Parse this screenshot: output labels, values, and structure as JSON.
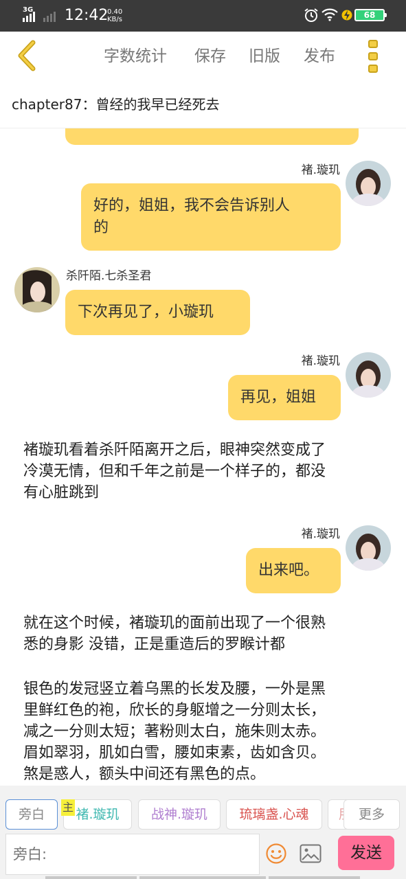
{
  "status_bar": {
    "network": "3G",
    "time": "12:42",
    "speed_value": "0.40",
    "speed_unit": "KB/s",
    "battery": "68",
    "icons": [
      "alarm-icon",
      "wifi-icon",
      "charging-icon",
      "battery-icon"
    ]
  },
  "toolbar": {
    "word_count": "字数统计",
    "save": "保存",
    "old_version": "旧版",
    "publish": "发布"
  },
  "chapter": {
    "title": "chapter87：曾经的我早已经死去"
  },
  "messages": [
    {
      "type": "right",
      "name": "褚.璇玑",
      "text_line1": "好的，姐姐，我不会告诉别人",
      "text_line2": "的"
    },
    {
      "type": "left",
      "name": "杀阡陌.七杀圣君",
      "text": "下次再见了，小璇玑"
    },
    {
      "type": "right",
      "name": "褚.璇玑",
      "text": "再见，姐姐"
    },
    {
      "type": "narration",
      "lines": [
        "褚璇玑看着杀阡陌离开之后，眼神突然变成了",
        "冷漠无情，但和千年之前是一个样子的，都没",
        "有心脏跳到"
      ]
    },
    {
      "type": "right",
      "name": "褚.璇玑",
      "text": "出来吧。"
    },
    {
      "type": "narration",
      "lines": [
        "就在这个时候，褚璇玑的面前出现了一个很熟",
        "悉的身影 没错，正是重造后的罗睺计都"
      ]
    },
    {
      "type": "narration",
      "lines": [
        "银色的发冠竖立着乌黑的长发及腰，一外是黑",
        "里鲜红色的袍，欣长的身躯增之一分则太长，",
        "减之一分则太短；著粉则太白，施朱则太赤。",
        "眉如翠羽，肌如白雪，腰如束素，齿如含贝。",
        "煞是惑人，额头中间还有黑色的点。"
      ]
    }
  ],
  "roles": {
    "host_badge": "主",
    "items": [
      {
        "label": "旁白",
        "color": "#888888"
      },
      {
        "label": "褚.璇玑",
        "color": "#3fb8b0"
      },
      {
        "label": "战神.璇玑",
        "color": "#b07fd0"
      },
      {
        "label": "琉璃盏.心魂",
        "color": "#d9534f"
      },
      {
        "label": "朋",
        "color": "#e6a0a0"
      }
    ],
    "more": "更多"
  },
  "input": {
    "placeholder": "旁白:",
    "send": "发送"
  },
  "colors": {
    "bubble": "#ffd96a",
    "send_button": "#ff6f97",
    "accent_yellow": "#f3ce45"
  }
}
